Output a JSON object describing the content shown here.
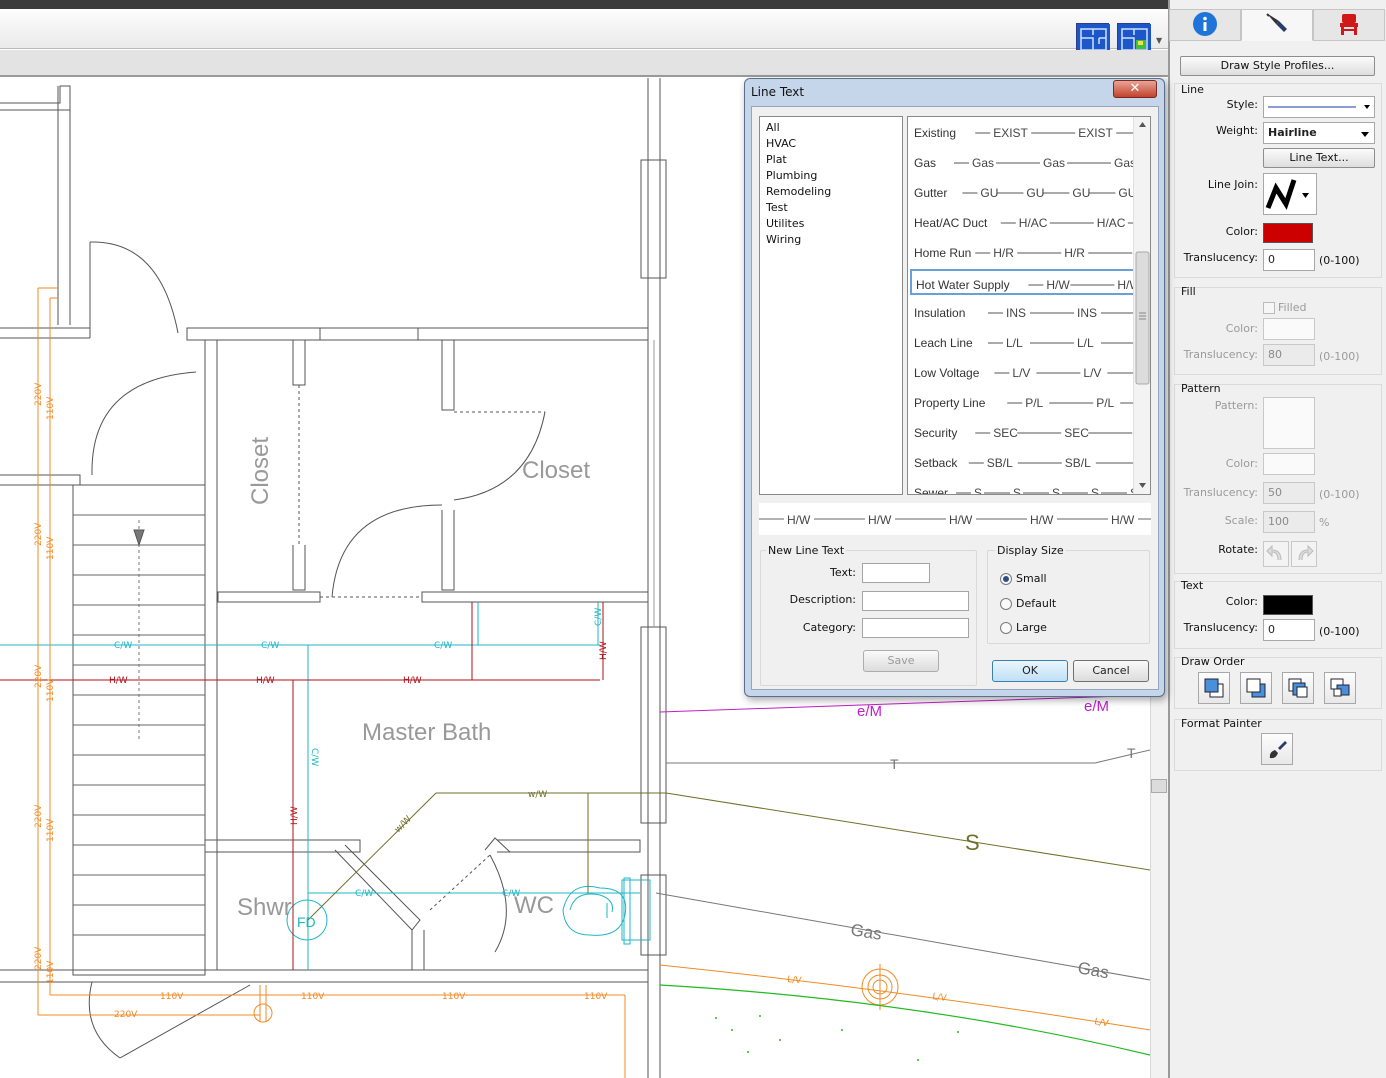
{
  "app": {
    "toolbar_icons": [
      "floor-plan-icon",
      "floor-plan-color-icon"
    ]
  },
  "canvas": {
    "rooms": {
      "closet_left": "Closet",
      "closet_right": "Closet",
      "master_bath": "Master Bath",
      "shower": "Shwr",
      "wc": "WC",
      "floor_drain": "FD"
    },
    "line_labels": {
      "cold_water": "C/W",
      "hot_water": "H/W",
      "waste_water": "w/W",
      "volt_110": "110V",
      "volt_220": "220V",
      "electric_meter": "e/M",
      "telephone": "T",
      "sewer": "S",
      "gas": "Gas",
      "low_voltage": "L/V"
    },
    "colors": {
      "cold_water": "#1fb7c4",
      "hot_water": "#b0121b",
      "electrical": "#f08a24",
      "sewer": "#6f6f2a",
      "electric_meter": "#c21fc9",
      "gas": "#777777",
      "grass": "#22bb22"
    }
  },
  "panel": {
    "tabs": [
      {
        "name": "info",
        "icon": "info-icon"
      },
      {
        "name": "draw-style",
        "icon": "pen-icon",
        "active": true
      },
      {
        "name": "furniture",
        "icon": "chair-icon"
      }
    ],
    "draw_style_profiles_button": "Draw Style Profiles...",
    "line": {
      "title": "Line",
      "style_label": "Style:",
      "weight_label": "Weight:",
      "weight_value": "Hairline",
      "line_text_button": "Line Text...",
      "line_join_label": "Line Join:",
      "color_label": "Color:",
      "color_value": "#cc0000",
      "translucency_label": "Translucency:",
      "translucency_value": "0",
      "range": "(0-100)"
    },
    "fill": {
      "title": "Fill",
      "filled_label": "Filled",
      "color_label": "Color:",
      "translucency_label": "Translucency:",
      "translucency_value": "80",
      "range": "(0-100)"
    },
    "pattern": {
      "title": "Pattern",
      "pattern_label": "Pattern:",
      "color_label": "Color:",
      "translucency_label": "Translucency:",
      "translucency_value": "50",
      "range": "(0-100)",
      "scale_label": "Scale:",
      "scale_value": "100",
      "scale_unit": "%",
      "rotate_label": "Rotate:"
    },
    "text": {
      "title": "Text",
      "color_label": "Color:",
      "color_value": "#000000",
      "translucency_label": "Translucency:",
      "translucency_value": "0",
      "range": "(0-100)"
    },
    "draw_order": {
      "title": "Draw Order"
    },
    "format_painter": {
      "title": "Format Painter"
    }
  },
  "dialog": {
    "title": "Line Text",
    "close": "✕",
    "categories": [
      "All",
      "HVAC",
      "Plat",
      "Plumbing",
      "Remodeling",
      "Test",
      "Utilites",
      "Wiring"
    ],
    "styles": [
      {
        "name": "Existing",
        "code": "EXIST"
      },
      {
        "name": "Gas",
        "code": "Gas"
      },
      {
        "name": "Gutter",
        "code": "GU"
      },
      {
        "name": "Heat/AC Duct",
        "code": "H/AC"
      },
      {
        "name": "Home Run",
        "code": "H/R"
      },
      {
        "name": "Hot Water Supply",
        "code": "H/W",
        "selected": true
      },
      {
        "name": "Insulation",
        "code": "INS"
      },
      {
        "name": "Leach Line",
        "code": "L/L"
      },
      {
        "name": "Low Voltage",
        "code": "L/V"
      },
      {
        "name": "Property Line",
        "code": "P/L"
      },
      {
        "name": "Security",
        "code": "SEC"
      },
      {
        "name": "Setback",
        "code": "SB/L"
      },
      {
        "name": "Sewer",
        "code": "S"
      }
    ],
    "preview_text": "H/W",
    "new_line_text": {
      "title": "New Line Text",
      "text_label": "Text:",
      "description_label": "Description:",
      "category_label": "Category:",
      "save_button": "Save"
    },
    "display_size": {
      "title": "Display Size",
      "options": [
        "Small",
        "Default",
        "Large"
      ],
      "selected": "Small"
    },
    "ok_button": "OK",
    "cancel_button": "Cancel"
  }
}
